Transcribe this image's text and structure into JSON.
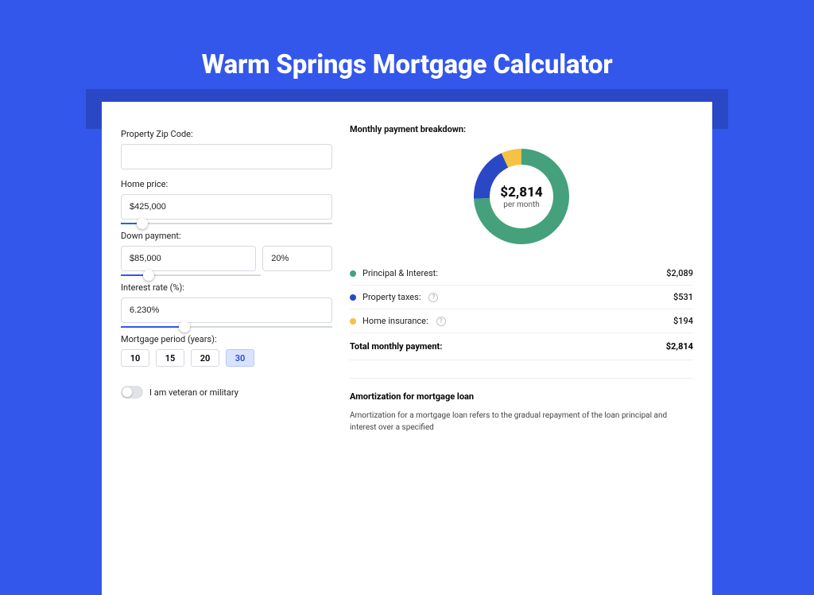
{
  "page": {
    "title": "Warm Springs Mortgage Calculator"
  },
  "form": {
    "zip_label": "Property Zip Code:",
    "zip_value": "",
    "home_price_label": "Home price:",
    "home_price_value": "$425,000",
    "home_price_slider_pct": 10,
    "down_payment_label": "Down payment:",
    "down_payment_value": "$85,000",
    "down_payment_pct": "20%",
    "down_payment_slider_pct": 20,
    "interest_rate_label": "Interest rate (%):",
    "interest_rate_value": "6.230%",
    "interest_rate_slider_pct": 30,
    "period_label": "Mortgage period (years):",
    "periods": [
      "10",
      "15",
      "20",
      "30"
    ],
    "period_selected": "30",
    "veteran_label": "I am veteran or military",
    "veteran_on": false
  },
  "breakdown": {
    "title": "Monthly payment breakdown:",
    "center_amount": "$2,814",
    "center_sub": "per month",
    "legend": [
      {
        "label": "Principal & Interest:",
        "value": "$2,089",
        "color": "#44a17b",
        "help": false
      },
      {
        "label": "Property taxes:",
        "value": "$531",
        "color": "#2a48c6",
        "help": true
      },
      {
        "label": "Home insurance:",
        "value": "$194",
        "color": "#f4c244",
        "help": true
      }
    ],
    "total_label": "Total monthly payment:",
    "total_value": "$2,814"
  },
  "chart_data": {
    "type": "pie",
    "title": "Monthly payment breakdown",
    "series": [
      {
        "name": "Principal & Interest",
        "value": 2089,
        "color": "#44a17b"
      },
      {
        "name": "Property taxes",
        "value": 531,
        "color": "#2a48c6"
      },
      {
        "name": "Home insurance",
        "value": 194,
        "color": "#f4c244"
      }
    ],
    "total": 2814
  },
  "amortization": {
    "title": "Amortization for mortgage loan",
    "body": "Amortization for a mortgage loan refers to the gradual repayment of the loan principal and interest over a specified"
  }
}
